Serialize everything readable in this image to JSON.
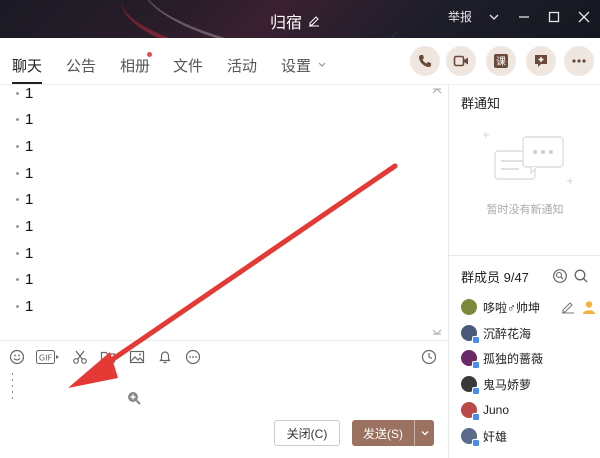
{
  "window": {
    "title": "归宿",
    "report_label": "举报",
    "controls": [
      "chevron-down-icon",
      "minimize-icon",
      "maximize-icon",
      "close-icon"
    ]
  },
  "tabs": [
    {
      "label": "聊天",
      "active": true
    },
    {
      "label": "公告"
    },
    {
      "label": "相册",
      "has_dot": true
    },
    {
      "label": "文件"
    },
    {
      "label": "活动"
    },
    {
      "label": "设置"
    }
  ],
  "action_buttons": [
    "phone-icon",
    "video-icon",
    "lesson-icon",
    "add-app-icon",
    "more-icon"
  ],
  "chat": {
    "messages": [
      "1",
      "1",
      "1",
      "1",
      "1",
      "1",
      "1",
      "1",
      "1"
    ]
  },
  "input": {
    "toolbar": [
      "emoji-icon",
      "gif-icon",
      "scissors-icon",
      "folder-icon",
      "image-icon",
      "bell-icon",
      "more-icon",
      "clock-icon"
    ],
    "gif_label": "GIF",
    "close_label": "关闭(C)",
    "send_label": "发送(S)"
  },
  "notice": {
    "title": "群通知",
    "empty_text": "暂时没有新通知"
  },
  "members": {
    "title": "群成员 9/47",
    "list": [
      {
        "name": "哆啦♂帅坤",
        "color": "#7a8a3a"
      },
      {
        "name": "沉醉花海",
        "color": "#4a5a7a"
      },
      {
        "name": "孤独的蔷薇",
        "color": "#6a2a6a"
      },
      {
        "name": "鬼马娇萝",
        "color": "#3a3a3a"
      },
      {
        "name": "Juno",
        "color": "#b84a4a"
      },
      {
        "name": "奸雄",
        "color": "#5a6a8a"
      }
    ]
  },
  "colors": {
    "accent": "#9b7260",
    "arrow": "#e53935"
  }
}
